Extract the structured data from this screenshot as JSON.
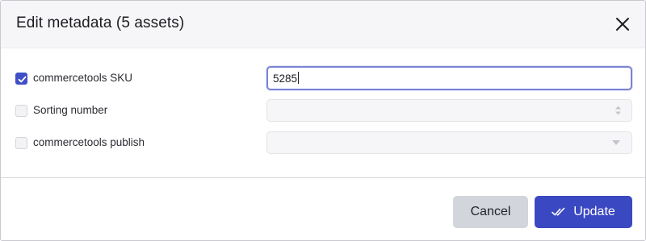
{
  "dialog": {
    "title": "Edit metadata (5 assets)"
  },
  "fields": [
    {
      "label": "commercetools SKU",
      "checked": true,
      "value": "5285",
      "type": "text"
    },
    {
      "label": "Sorting number",
      "checked": false,
      "value": "",
      "type": "number"
    },
    {
      "label": "commercetools publish",
      "checked": false,
      "value": "",
      "type": "select"
    }
  ],
  "footer": {
    "cancel_label": "Cancel",
    "update_label": "Update"
  },
  "colors": {
    "accent": "#3a48c2",
    "checkbox_checked": "#3f4fc6",
    "cancel_bg": "#d3d5dc",
    "header_bg": "#f6f6f8"
  },
  "icons": {
    "close": "close-icon",
    "checkmark": "checkmark-icon",
    "update": "double-check-icon",
    "spinner": "spinner-arrows-icon",
    "dropdown": "chevron-down-icon"
  }
}
